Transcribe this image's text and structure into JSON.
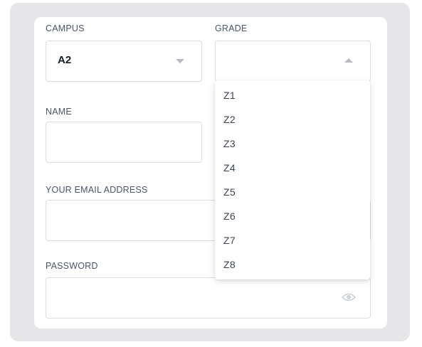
{
  "form": {
    "campus": {
      "label": "CAMPUS",
      "value": "A2"
    },
    "grade": {
      "label": "GRADE",
      "value": "",
      "options": [
        "Z1",
        "Z2",
        "Z3",
        "Z4",
        "Z5",
        "Z6",
        "Z7",
        "Z8"
      ]
    },
    "name": {
      "label": "NAME",
      "value": ""
    },
    "email": {
      "label": "YOUR EMAIL ADDRESS",
      "value": ""
    },
    "password": {
      "label": "PASSWORD",
      "value": ""
    }
  },
  "icons": {
    "campus_dropdown": "chevron-down-icon",
    "grade_dropdown": "chevron-up-icon",
    "password_toggle": "eye-icon"
  },
  "colors": {
    "frame_bg": "#e6e6e8",
    "card_bg": "#ffffff",
    "border": "#d9dce2",
    "label_text": "#4b5566",
    "icon": "#b5bac3"
  }
}
